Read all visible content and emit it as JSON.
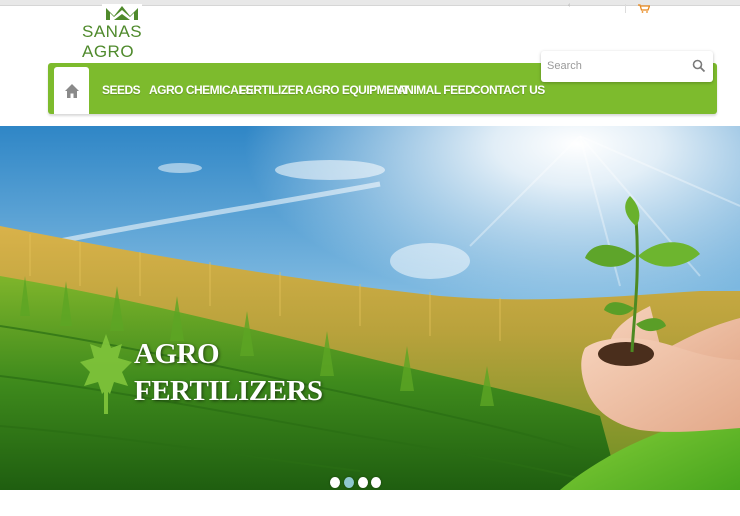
{
  "brand": {
    "name": "SANAS AGRO",
    "color": "#4f8a2c"
  },
  "nav": {
    "accent": "#7dbb2d",
    "home_icon": "home-icon",
    "items": [
      {
        "label": "SEEDS"
      },
      {
        "label": "AGRO CHEMICALS"
      },
      {
        "label": "FERTILIZER"
      },
      {
        "label": "AGRO EQUIPMENT"
      },
      {
        "label": "ANIMAL FEED"
      },
      {
        "label": "CONTACT US"
      }
    ]
  },
  "search": {
    "placeholder": "Search",
    "icon": "search-icon"
  },
  "top_bar": {
    "cart_icon": "cart-icon"
  },
  "hero": {
    "title_line1": "AGRO",
    "title_line2": "FERTILIZERS",
    "leaf_icon": "maple-leaf-icon",
    "slides": [
      {
        "active": false
      },
      {
        "active": true
      },
      {
        "active": false
      },
      {
        "active": false
      }
    ]
  }
}
